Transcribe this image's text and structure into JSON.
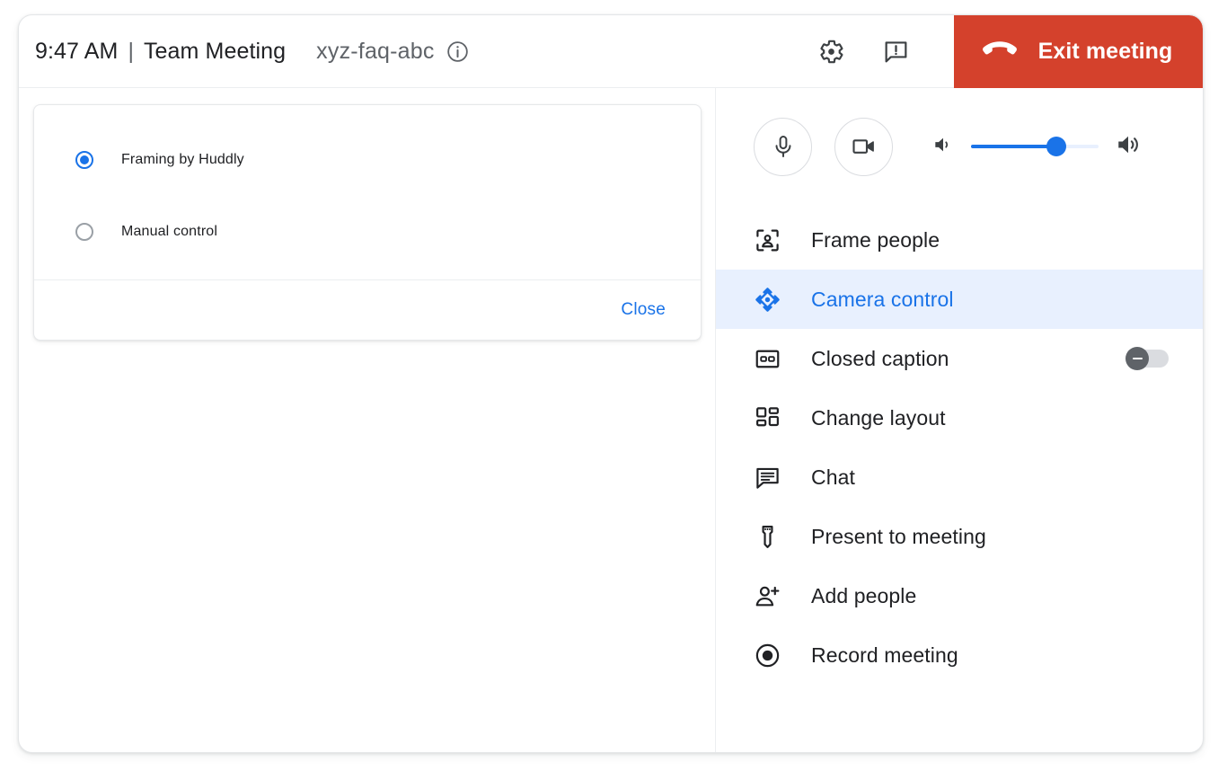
{
  "header": {
    "time": "9:47 AM",
    "separator": "|",
    "meeting_title": "Team Meeting",
    "meeting_code": "xyz-faq-abc",
    "info_icon": "info-icon",
    "settings_icon": "gear-icon",
    "feedback_icon": "feedback-icon",
    "exit_label": "Exit meeting",
    "exit_icon": "hangup-phone-icon",
    "exit_color": "#d4412c"
  },
  "dialog": {
    "options": [
      {
        "label": "Framing by Huddly",
        "selected": true
      },
      {
        "label": "Manual control",
        "selected": false
      }
    ],
    "close_label": "Close",
    "link_color": "#1a73e8"
  },
  "av_controls": {
    "mic_icon": "microphone-icon",
    "camera_icon": "videocam-icon",
    "volume_low_icon": "volume-low-icon",
    "volume_high_icon": "volume-high-icon",
    "volume_percent": 67,
    "slider_color": "#1a73e8"
  },
  "menu": {
    "items": [
      {
        "label": "Frame people",
        "icon": "frame-people-icon",
        "active": false,
        "toggle": null
      },
      {
        "label": "Camera control",
        "icon": "camera-control-icon",
        "active": true,
        "toggle": null
      },
      {
        "label": "Closed caption",
        "icon": "closed-caption-icon",
        "active": false,
        "toggle": "off"
      },
      {
        "label": "Change layout",
        "icon": "change-layout-icon",
        "active": false,
        "toggle": null
      },
      {
        "label": "Chat",
        "icon": "chat-icon",
        "active": false,
        "toggle": null
      },
      {
        "label": "Present to meeting",
        "icon": "hdmi-connector-icon",
        "active": false,
        "toggle": null
      },
      {
        "label": "Add people",
        "icon": "add-person-icon",
        "active": false,
        "toggle": null
      },
      {
        "label": "Record meeting",
        "icon": "record-icon",
        "active": false,
        "toggle": null
      }
    ],
    "active_color": "#1a73e8",
    "active_bg": "#e8f0fe"
  }
}
